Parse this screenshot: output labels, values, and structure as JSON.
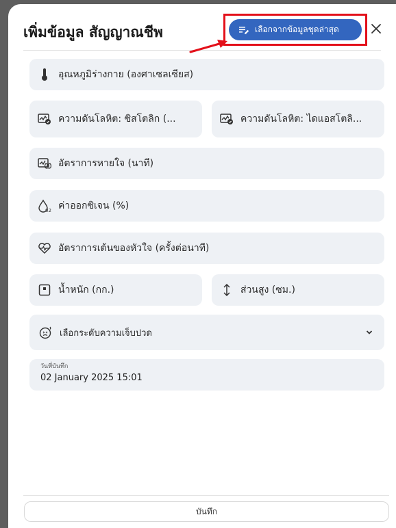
{
  "dialog": {
    "title": "เพิ่มข้อมูล สัญญาณชีพ",
    "latest_button_label": "เลือกจากข้อมูลชุดล่าสุด",
    "close_label": "×"
  },
  "fields": {
    "temperature": "อุณหภูมิร่างกาย (องศาเซลเซียส)",
    "bp_systolic": "ความดันโลหิต: ซิสโตลิก (...",
    "bp_diastolic": "ความดันโลหิต: ไดแอสโตลิ...",
    "respiratory_rate": "อัตราการหายใจ (นาที)",
    "oxygen": "ค่าออกซิเจน (%)",
    "heart_rate": "อัตราการเต้นของหัวใจ (ครั้งต่อนาที)",
    "weight": "น้ำหนัก (กก.)",
    "height": "ส่วนสูง (ซม.)",
    "pain_level_placeholder": "เลือกระดับความเจ็บปวด"
  },
  "record_date": {
    "label": "วันที่บันทึก",
    "value": "02 January 2025 15:01"
  },
  "footer": {
    "save_label": "บันทึก"
  },
  "colors": {
    "accent": "#3366bf",
    "highlight": "#e3101a",
    "field_bg": "#eef1f5"
  },
  "icons": {
    "latest_button": "list-edit-icon",
    "close": "close-icon",
    "temperature": "thermometer-icon",
    "bp_systolic": "blood-pressure-icon",
    "bp_diastolic": "blood-pressure-icon",
    "respiratory_rate": "lungs-icon",
    "oxygen": "oxygen-drop-icon",
    "heart_rate": "heart-pulse-icon",
    "weight": "scale-icon",
    "height": "height-arrows-icon",
    "pain_level": "pain-face-icon",
    "dropdown": "chevron-down-icon"
  }
}
